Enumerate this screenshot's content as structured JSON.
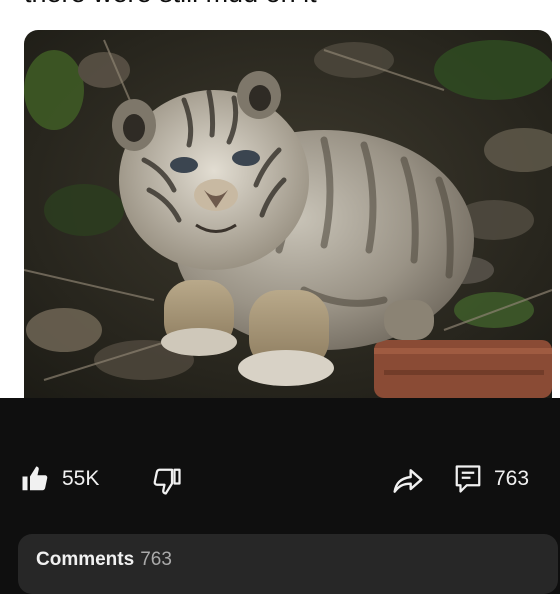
{
  "post": {
    "caption": "there were still mud on it"
  },
  "image": {
    "subject_icon": "tiger-cub-photo"
  },
  "actions": {
    "like_count": "55K",
    "comment_count": "763"
  },
  "comments_section": {
    "title": "Comments",
    "count": "763"
  },
  "colors": {
    "background_top": "#ffffff",
    "background_bottom": "#0f0f0f",
    "card": "#272727",
    "text": "#f1f1f1",
    "muted": "#aaaaaa"
  }
}
